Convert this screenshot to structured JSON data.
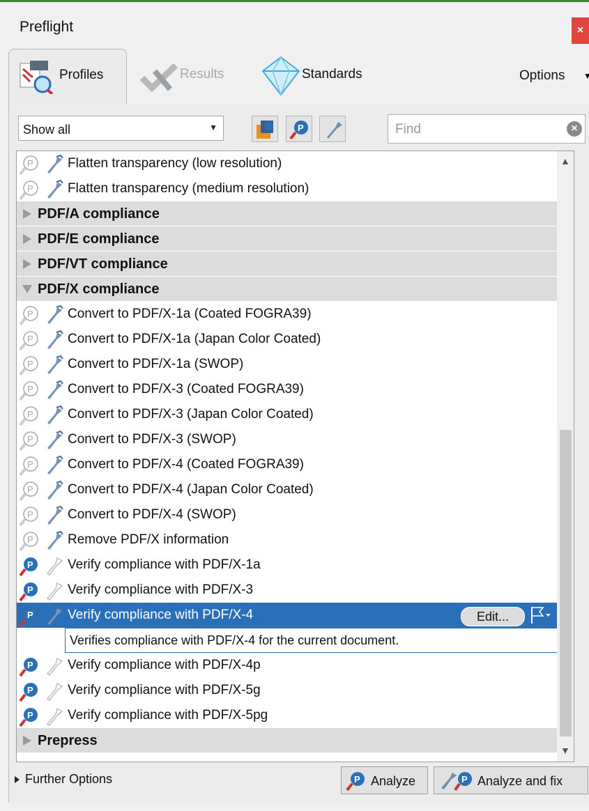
{
  "window": {
    "title": "Preflight",
    "close_glyph": "×"
  },
  "tabs": [
    {
      "label": "Profiles",
      "icon": "profiles-icon",
      "active": true
    },
    {
      "label": "Results",
      "icon": "results-icon",
      "active": false
    },
    {
      "label": "Standards",
      "icon": "standards-icon",
      "active": false
    }
  ],
  "options": {
    "label": "Options"
  },
  "toolbar": {
    "filter_value": "Show all",
    "find_placeholder": "Find",
    "buttons": [
      "favorites-icon",
      "analyze-profiles-icon",
      "fixup-profiles-icon"
    ]
  },
  "list": {
    "top_items": [
      {
        "label": "Flatten transparency (low resolution)",
        "icons": [
          "check-gray",
          "fixup-blue"
        ]
      },
      {
        "label": "Flatten transparency (medium resolution)",
        "icons": [
          "check-gray",
          "fixup-blue"
        ]
      }
    ],
    "categories": [
      {
        "label": "PDF/A compliance",
        "expanded": false
      },
      {
        "label": "PDF/E compliance",
        "expanded": false
      },
      {
        "label": "PDF/VT compliance",
        "expanded": false
      },
      {
        "label": "PDF/X compliance",
        "expanded": true
      }
    ],
    "pdfx_items": [
      {
        "label": "Convert to PDF/X-1a (Coated FOGRA39)",
        "type": "fixup"
      },
      {
        "label": "Convert to PDF/X-1a (Japan Color Coated)",
        "type": "fixup"
      },
      {
        "label": "Convert to PDF/X-1a (SWOP)",
        "type": "fixup"
      },
      {
        "label": "Convert to PDF/X-3 (Coated FOGRA39)",
        "type": "fixup"
      },
      {
        "label": "Convert to PDF/X-3 (Japan Color Coated)",
        "type": "fixup"
      },
      {
        "label": "Convert to PDF/X-3 (SWOP)",
        "type": "fixup"
      },
      {
        "label": "Convert to PDF/X-4 (Coated FOGRA39)",
        "type": "fixup"
      },
      {
        "label": "Convert to PDF/X-4 (Japan Color Coated)",
        "type": "fixup"
      },
      {
        "label": "Convert to PDF/X-4 (SWOP)",
        "type": "fixup"
      },
      {
        "label": "Remove PDF/X information",
        "type": "fixup"
      },
      {
        "label": "Verify compliance with PDF/X-1a",
        "type": "verify"
      },
      {
        "label": "Verify compliance with PDF/X-3",
        "type": "verify"
      }
    ],
    "selected": {
      "label": "Verify compliance with PDF/X-4",
      "edit_label": "Edit...",
      "description": "Verifies compliance with PDF/X-4 for the current document."
    },
    "after_items": [
      {
        "label": "Verify compliance with PDF/X-4p",
        "type": "verify"
      },
      {
        "label": "Verify compliance with PDF/X-5g",
        "type": "verify"
      },
      {
        "label": "Verify compliance with PDF/X-5pg",
        "type": "verify"
      }
    ],
    "bottom_category": {
      "label": "Prepress",
      "expanded": false
    }
  },
  "footer": {
    "further_options": "Further Options",
    "analyze": "Analyze",
    "analyze_fix": "Analyze and fix"
  },
  "colors": {
    "selection": "#2a70b8",
    "category_bg": "#dcdcdc",
    "close_red": "#e0473c"
  }
}
